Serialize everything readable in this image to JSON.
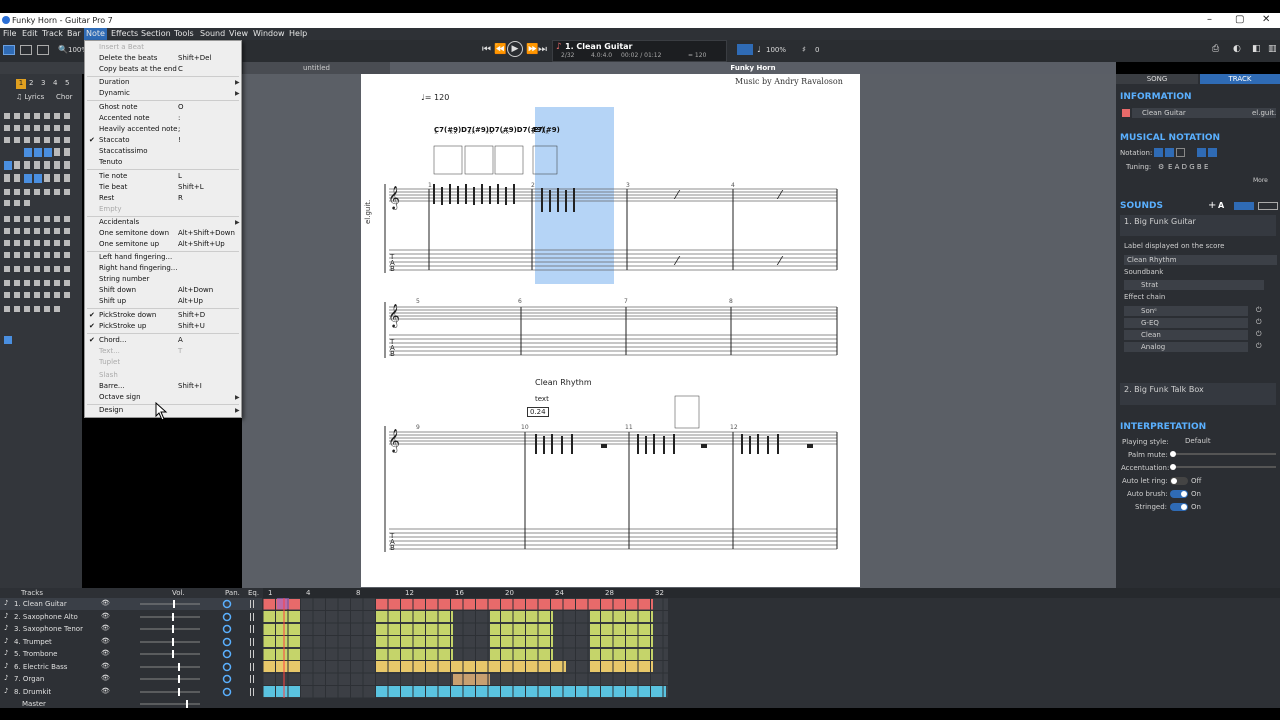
{
  "window": {
    "title": "Funky Horn - Guitar Pro 7"
  },
  "menubar": [
    "File",
    "Edit",
    "Track",
    "Bar",
    "Note",
    "Effects",
    "Section",
    "Tools",
    "Sound",
    "View",
    "Window",
    "Help"
  ],
  "toolbar": {
    "zoom": "100%",
    "lcd": {
      "track": "1. Clean Guitar",
      "bar": "2/32",
      "sig": "4.0:4.0",
      "time": "00:02 / 01:12",
      "tempo": "= 120"
    },
    "zoom_right": "100%",
    "transpose": "0"
  },
  "tabs": {
    "untitled": "untitled",
    "current": "Funky Horn"
  },
  "left": {
    "nums": [
      "1",
      "2",
      "3",
      "4",
      "5"
    ],
    "lyrics": "Lyrics",
    "chords": "Chor"
  },
  "note_menu": [
    {
      "label": "Insert a Beat",
      "shortcut": "",
      "disabled": true
    },
    {
      "label": "Delete the beats",
      "shortcut": "Shift+Del"
    },
    {
      "label": "Copy beats at the end",
      "shortcut": "C"
    },
    {
      "label": "Duration",
      "arrow": true
    },
    {
      "label": "Dynamic",
      "arrow": true
    },
    {
      "label": "Ghost note",
      "shortcut": "O"
    },
    {
      "label": "Accented note",
      "shortcut": ":"
    },
    {
      "label": "Heavily accented note",
      "shortcut": ";"
    },
    {
      "label": "Staccato",
      "shortcut": "!",
      "checked": true
    },
    {
      "label": "Staccatissimo"
    },
    {
      "label": "Tenuto"
    },
    {
      "label": "Tie note",
      "shortcut": "L"
    },
    {
      "label": "Tie beat",
      "shortcut": "Shift+L"
    },
    {
      "label": "Rest",
      "shortcut": "R"
    },
    {
      "label": "Empty",
      "disabled": true
    },
    {
      "label": "Accidentals",
      "arrow": true
    },
    {
      "label": "One semitone down",
      "shortcut": "Alt+Shift+Down"
    },
    {
      "label": "One semitone up",
      "shortcut": "Alt+Shift+Up"
    },
    {
      "label": "Left hand fingering..."
    },
    {
      "label": "Right hand fingering..."
    },
    {
      "label": "String number"
    },
    {
      "label": "Shift down",
      "shortcut": "Alt+Down"
    },
    {
      "label": "Shift up",
      "shortcut": "Alt+Up"
    },
    {
      "label": "PickStroke down",
      "shortcut": "Shift+D",
      "checked": true
    },
    {
      "label": "PickStroke up",
      "shortcut": "Shift+U",
      "checked": true
    },
    {
      "label": "Chord...",
      "shortcut": "A",
      "checked": true
    },
    {
      "label": "Text...",
      "shortcut": "T",
      "disabled": true
    },
    {
      "label": "Tuplet",
      "disabled": true
    },
    {
      "label": "Slash",
      "disabled": true
    },
    {
      "label": "Barre...",
      "shortcut": "Shift+I"
    },
    {
      "label": "Octave sign",
      "arrow": true
    },
    {
      "label": "Design",
      "arrow": true
    }
  ],
  "score": {
    "credit": "Music by Andry Ravaloson",
    "tempo": "= 120",
    "chords": "C7(#9)D7(#9)D7(#9)D7(#9)",
    "chord2": "E7(#9)",
    "section": "Clean Rhythm",
    "text_label": "text",
    "text_box": "0.24",
    "instrument": "el.guit.",
    "bar_nums": [
      "1",
      "2",
      "3",
      "4",
      "5",
      "6",
      "7",
      "8",
      "9",
      "10",
      "11",
      "12"
    ]
  },
  "right": {
    "tab_song": "SONG",
    "tab_track": "TRACK",
    "information": "INFORMATION",
    "track_name": "Clean Guitar",
    "track_short": "el.guit.",
    "musical_notation": "MUSICAL NOTATION",
    "notation_label": "Notation:",
    "tuning_label": "Tuning:",
    "tuning": "E A D G B E",
    "more": "More",
    "sounds": "SOUNDS",
    "sound1": "1. Big Funk Guitar",
    "label_displayed": "Label displayed on the score",
    "label_value": "Clean Rhythm",
    "soundbank": "Soundbank",
    "soundbank_value": "Strat",
    "effect_chain": "Effect chain",
    "effects": [
      "Sonᵉ",
      "G-EQ",
      "Clean",
      "Analog"
    ],
    "sound2": "2. Big Funk Talk Box",
    "interpretation": "INTERPRETATION",
    "playing_style_label": "Playing style:",
    "playing_style": "Default",
    "palm_mute": "Palm mute:",
    "accentuation": "Accentuation:",
    "auto_let_ring": "Auto let ring:",
    "auto_let_ring_val": "Off",
    "auto_brush": "Auto brush:",
    "auto_brush_val": "On",
    "stringed": "Stringed:",
    "stringed_val": "On"
  },
  "tracks": {
    "header": "Tracks",
    "vol": "Vol.",
    "pan": "Pan.",
    "eq": "Eq.",
    "ruler": [
      "1",
      "4",
      "8",
      "12",
      "16",
      "20",
      "24",
      "28",
      "32"
    ],
    "list": [
      {
        "name": "1. Clean Guitar",
        "color": "#e86a6a"
      },
      {
        "name": "2. Saxophone  Alto",
        "color": "#c5d46a"
      },
      {
        "name": "3. Saxophone  Tenor",
        "color": "#c5d46a"
      },
      {
        "name": "4. Trumpet",
        "color": "#c5d46a"
      },
      {
        "name": "5. Trombone",
        "color": "#c5d46a"
      },
      {
        "name": "6. Electric Bass",
        "color": "#e8c86a"
      },
      {
        "name": "7. Organ",
        "color": "#c9a070"
      },
      {
        "name": "8. Drumkit",
        "color": "#5ac3e0"
      }
    ],
    "master": "Master"
  }
}
